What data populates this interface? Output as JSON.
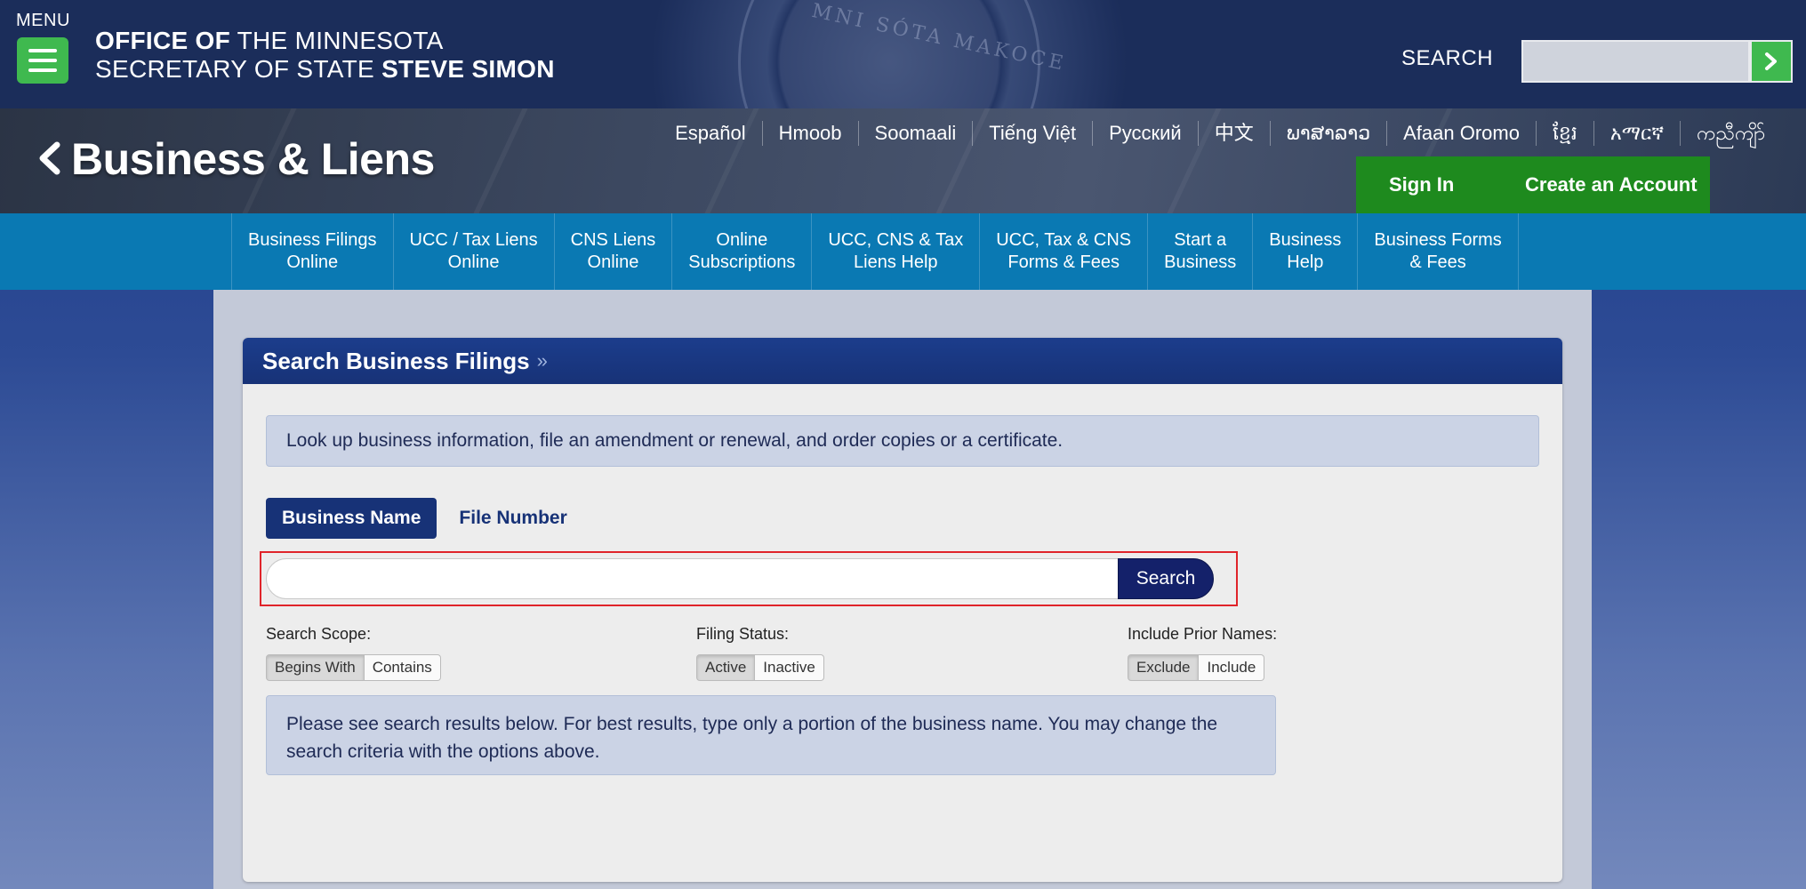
{
  "header": {
    "menu_label": "MENU",
    "office_line1_bold": "OFFICE OF",
    "office_line1_thin": " THE MINNESOTA",
    "office_line2_thin": "SECRETARY OF STATE ",
    "office_line2_bold": "STEVE SIMON",
    "seal_text": "MNI SÓTA MAKOCE",
    "search_label": "SEARCH",
    "search_placeholder": ""
  },
  "banner": {
    "title": "Business & Liens",
    "languages": [
      "Español",
      "Hmoob",
      "Soomaali",
      "Tiếng Việt",
      "Русский",
      "中文",
      "ພາສາລາວ",
      "Afaan Oromo",
      "ខ្មែរ",
      "አማርኛ",
      "ကညီကျိာ်"
    ],
    "sign_in": "Sign In",
    "create_account": "Create an Account"
  },
  "nav": {
    "items": [
      [
        "Business Filings",
        "Online"
      ],
      [
        "UCC / Tax Liens",
        "Online"
      ],
      [
        "CNS Liens",
        "Online"
      ],
      [
        "Online",
        "Subscriptions"
      ],
      [
        "UCC, CNS & Tax",
        "Liens Help"
      ],
      [
        "UCC, Tax & CNS",
        "Forms & Fees"
      ],
      [
        "Start a",
        "Business"
      ],
      [
        "Business",
        "Help"
      ],
      [
        "Business Forms",
        "& Fees"
      ]
    ]
  },
  "card": {
    "title": "Search Business Filings",
    "raquo": "»",
    "info": "Look up business information, file an amendment or renewal, and order copies or a certificate.",
    "tab_active": "Business Name",
    "tab_inactive": "File Number",
    "search_value": "",
    "search_button": "Search",
    "options": [
      {
        "label": "Search Scope:",
        "choices": [
          "Begins With",
          "Contains"
        ],
        "selected": "Begins With"
      },
      {
        "label": "Filing Status:",
        "choices": [
          "Active",
          "Inactive"
        ],
        "selected": "Active"
      },
      {
        "label": "Include Prior Names:",
        "choices": [
          "Exclude",
          "Include"
        ],
        "selected": "Exclude"
      }
    ],
    "results_note_line1": "Please see search results below. For best results, type only a portion of the business name. You may change the",
    "results_note_line2": "search criteria with the options above."
  },
  "colors": {
    "header_bg": "#1b2d5a",
    "green": "#3fb94f",
    "account_green": "#1e8a1e",
    "nav_blue": "#0a79b3",
    "card_header": "#173277",
    "search_button": "#14216a",
    "highlight_red": "#e0242a"
  }
}
